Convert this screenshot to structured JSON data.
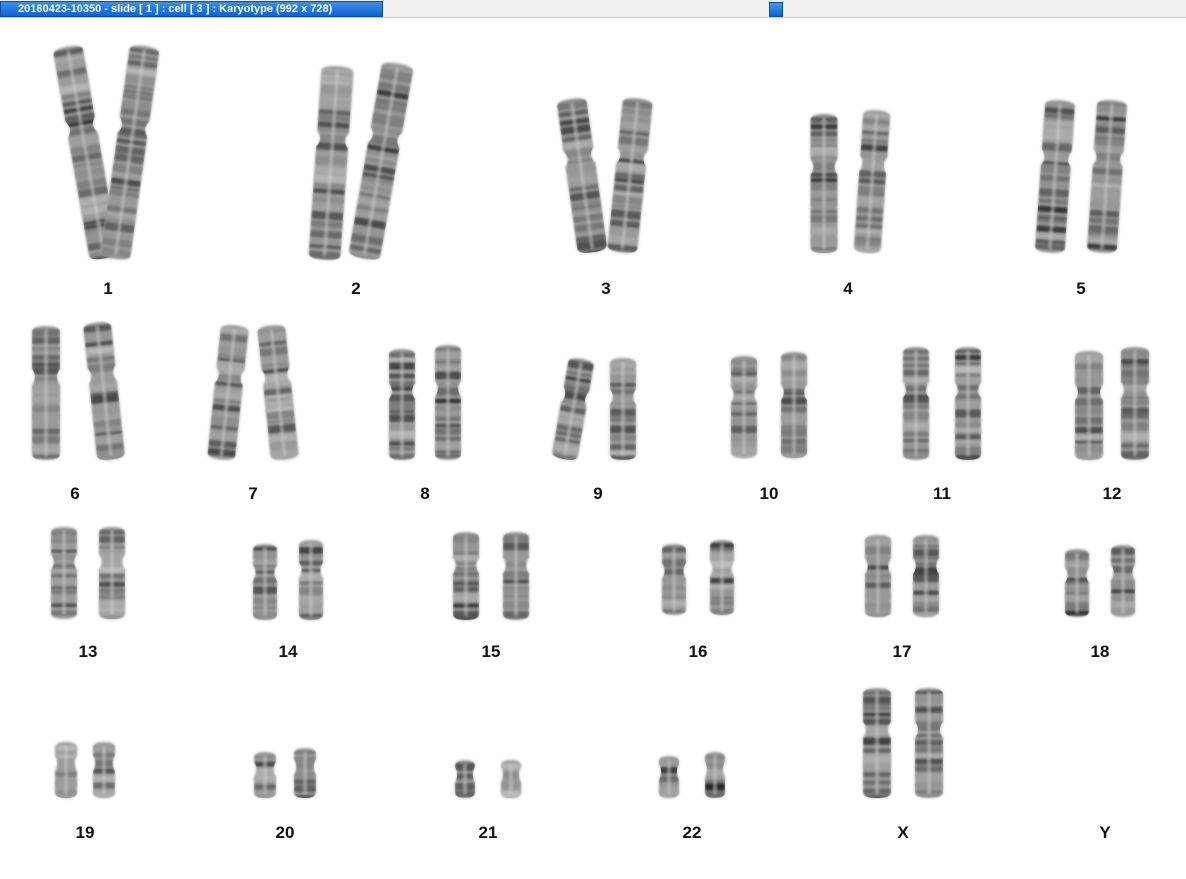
{
  "window": {
    "title": "20180423-10350 - slide [ 1 ] : cell [ 3 ] : Karyotype  (992 x 728)"
  },
  "karyotype": {
    "labels": [
      "1",
      "2",
      "3",
      "4",
      "5",
      "6",
      "7",
      "8",
      "9",
      "10",
      "11",
      "12",
      "13",
      "14",
      "15",
      "16",
      "17",
      "18",
      "19",
      "20",
      "21",
      "22",
      "X",
      "Y"
    ]
  }
}
